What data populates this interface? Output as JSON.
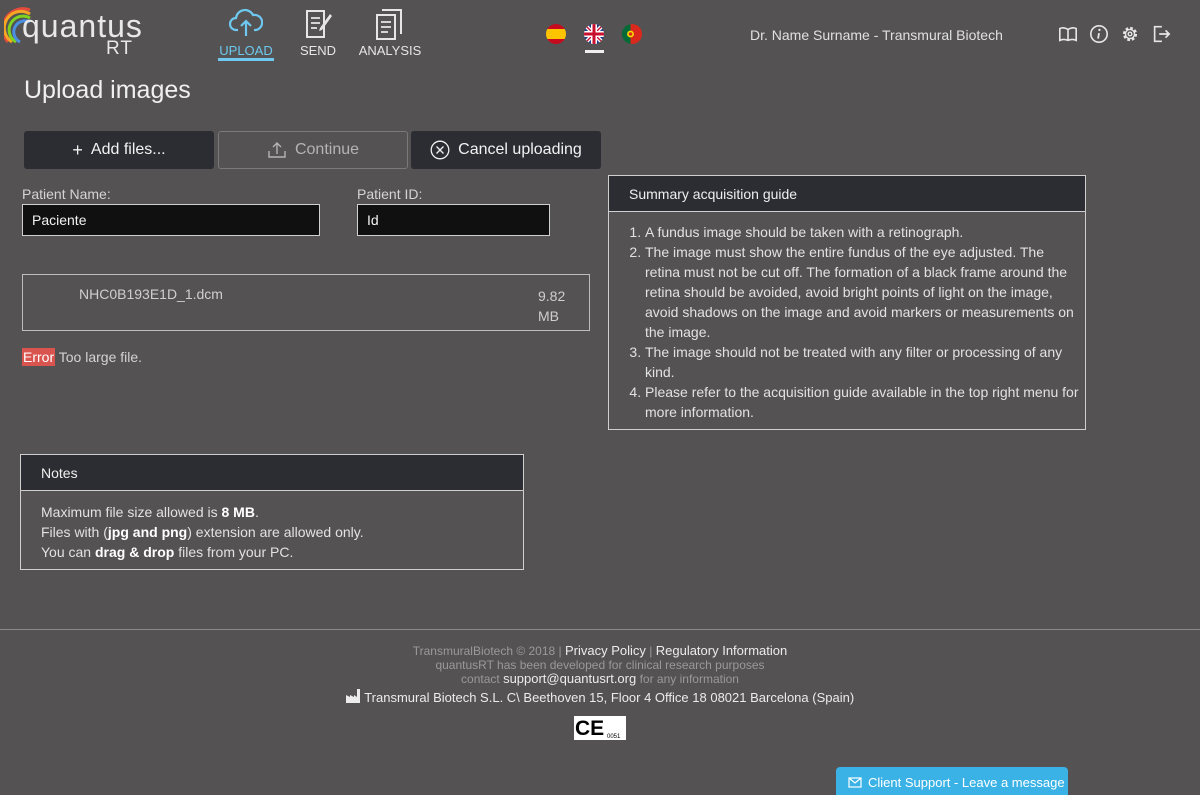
{
  "logo": {
    "word": "quantus",
    "suffix": "RT"
  },
  "nav": [
    {
      "label": "UPLOAD",
      "icon": "cloud-upload-icon",
      "active": true
    },
    {
      "label": "SEND",
      "icon": "send-document-icon",
      "active": false
    },
    {
      "label": "ANALYSIS",
      "icon": "analysis-document-icon",
      "active": false
    }
  ],
  "languages": [
    {
      "code": "es",
      "icon": "spanish-flag-icon"
    },
    {
      "code": "en",
      "icon": "english-flag-icon",
      "selected": true
    },
    {
      "code": "pt",
      "icon": "portuguese-flag-icon"
    }
  ],
  "user": {
    "name": "Dr. Name Surname - Transmural Biotech"
  },
  "tools": [
    "book-icon",
    "info-icon",
    "settings-icon",
    "logout-icon"
  ],
  "page": {
    "title": "Upload images"
  },
  "buttons": {
    "add": "Add files...",
    "continue": "Continue",
    "cancel": "Cancel uploading"
  },
  "patient": {
    "name_label": "Patient Name:",
    "name_value": "Paciente",
    "id_label": "Patient ID:",
    "id_value": "Id"
  },
  "file": {
    "name": "NHC0B193E1D_1.dcm",
    "size": "9.82 MB",
    "error_tag": "Error",
    "error_message": "Too large file."
  },
  "guide": {
    "title": "Summary acquisition guide",
    "items": [
      "A fundus image should be taken with a retinograph.",
      "The image must show the entire fundus of the eye adjusted. The retina must not be cut off. The formation of a black frame around the retina should be avoided, avoid bright points of light on the image, avoid shadows on the image and avoid markers or measurements on the image.",
      "The image should not be treated with any filter or processing of any kind.",
      "Please refer to the acquisition guide available in the top right menu for more information."
    ]
  },
  "notes": {
    "title": "Notes",
    "line1_pre": "Maximum file size allowed is ",
    "line1_bold": "8 MB",
    "line1_post": ".",
    "line2_pre": "Files with (",
    "line2_bold": "jpg and png",
    "line2_post": ") extension are allowed only.",
    "line3_pre": "You can ",
    "line3_bold": "drag & drop",
    "line3_post": " files from your PC."
  },
  "footer": {
    "copyright": "TransmuralBiotech © 2018 |",
    "privacy": "Privacy Policy",
    "sep": "|",
    "regulatory": "Regulatory Information",
    "developed": "quantusRT has been developed for clinical research purposes",
    "contact_pre": "contact",
    "email": "support@quantusrt.org",
    "contact_post": "for any information",
    "address": "Transmural Biotech S.L. C\\ Beethoven 15, Floor 4 Office 18 08021 Barcelona (Spain)",
    "ce_mark": "CE",
    "ce_number": "0051"
  },
  "support": {
    "label": "Client Support - Leave a message"
  },
  "colors": {
    "accent": "#6ec8ef",
    "error": "#d9534f",
    "background": "#545252",
    "dark": "#2b2d32",
    "support": "#3ab2e6"
  }
}
